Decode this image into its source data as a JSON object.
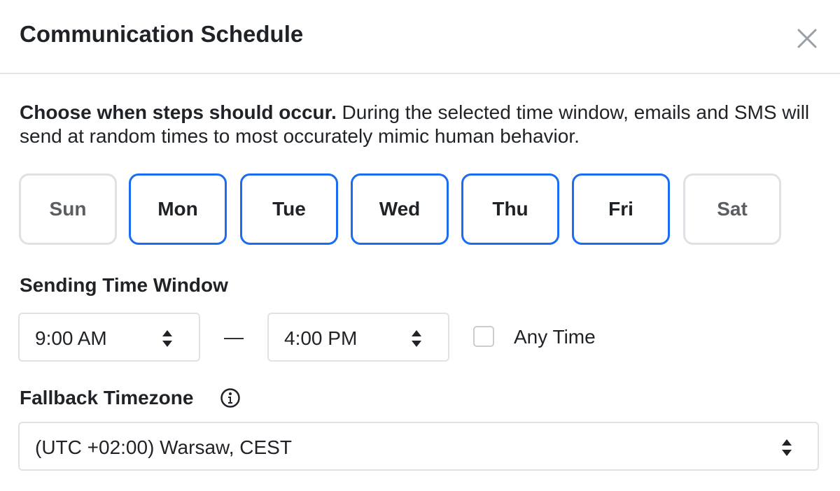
{
  "modal": {
    "title": "Communication Schedule"
  },
  "description": {
    "bold": "Choose when steps should occur.",
    "text": " During the selected time window, emails and SMS will send at random times to most occurately mimic human behavior."
  },
  "days": [
    {
      "label": "Sun",
      "selected": false
    },
    {
      "label": "Mon",
      "selected": true
    },
    {
      "label": "Tue",
      "selected": true
    },
    {
      "label": "Wed",
      "selected": true
    },
    {
      "label": "Thu",
      "selected": true
    },
    {
      "label": "Fri",
      "selected": true
    },
    {
      "label": "Sat",
      "selected": false
    }
  ],
  "sending_window": {
    "label": "Sending Time Window",
    "start": "9:00 AM",
    "separator": "—",
    "end": "4:00 PM",
    "any_time_label": "Any Time",
    "any_time_checked": false
  },
  "timezone": {
    "label": "Fallback Timezone",
    "value": "(UTC +02:00) Warsaw, CEST"
  },
  "colors": {
    "accent": "#1a6cf0",
    "unselected_border": "#dfe1e4",
    "text": "#1f2328"
  }
}
